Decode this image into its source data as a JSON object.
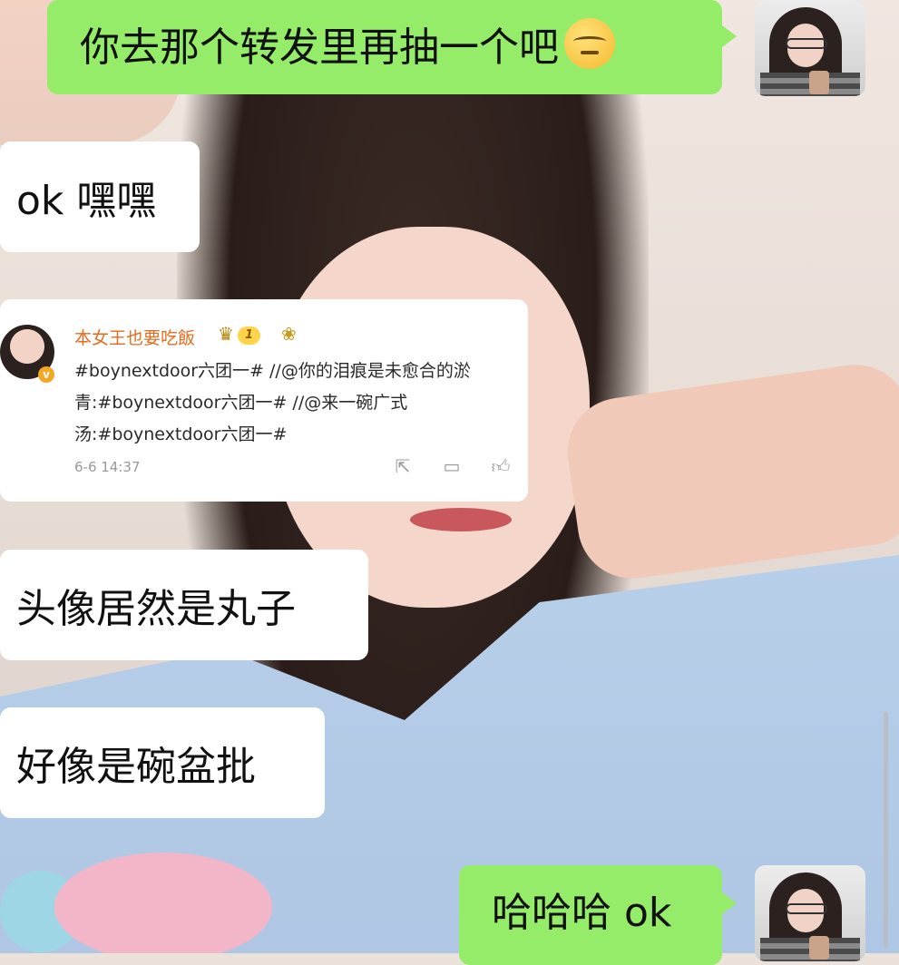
{
  "messages": [
    {
      "side": "right",
      "text": "你去那个转发里再抽一个吧",
      "emoji": "smirking-face-emoji"
    },
    {
      "side": "left",
      "text": "ok 嘿嘿"
    },
    {
      "side": "left",
      "type": "card"
    },
    {
      "side": "left",
      "text": "头像居然是丸子"
    },
    {
      "side": "left",
      "text": "好像是碗盆批"
    },
    {
      "side": "right",
      "text": "哈哈哈 ok"
    }
  ],
  "weibo_card": {
    "username": "本女王也要吃飯",
    "level": "1",
    "verified_mark": "v",
    "body": "#boynextdoor六团一# //@你的泪痕是未愈合的淤青:#boynextdoor六团一# //@来一碗广式汤:#boynextdoor六团一#",
    "time": "6-6 14:37",
    "icons": [
      "share-icon",
      "comment-icon",
      "like-icon"
    ]
  },
  "colors": {
    "right_bubble": "#95ec69",
    "left_bubble": "#ffffff",
    "username": "#e86a1c"
  }
}
